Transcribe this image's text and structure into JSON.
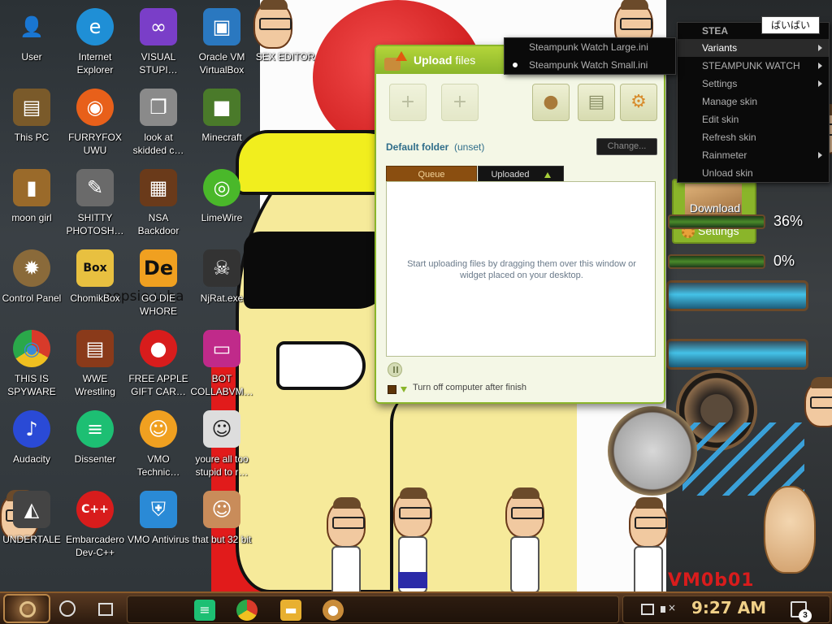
{
  "desktop": {
    "icons": [
      {
        "label": "User",
        "glyph": "👤",
        "color": "#5a4030"
      },
      {
        "label": "Internet Explorer",
        "glyph": "e",
        "color": "#1f8fd6"
      },
      {
        "label": "VISUAL STUPI…",
        "glyph": "∞",
        "color": "#7a3ec8"
      },
      {
        "label": "Oracle VM VirtualBox",
        "glyph": "▣",
        "color": "#2a78c0"
      },
      {
        "label": "SEX EDITOR",
        "glyph": "",
        "color": "#ffffff"
      },
      {
        "label": "This PC",
        "glyph": "▤",
        "color": "#7a5a2a"
      },
      {
        "label": "FURRYFOX UWU",
        "glyph": "◉",
        "color": "#e8601a"
      },
      {
        "label": "look at skidded c…",
        "glyph": "❐",
        "color": "#8a8a8a"
      },
      {
        "label": "Minecraft",
        "glyph": "■",
        "color": "#4a7a2a"
      },
      {
        "label": "moon girl",
        "glyph": "▮",
        "color": "#9a6a2a"
      },
      {
        "label": "SHITTY PHOTOSH…",
        "glyph": "✎",
        "color": "#6a6a6a"
      },
      {
        "label": "NSA Backdoor",
        "glyph": "▦",
        "color": "#6a3a1a"
      },
      {
        "label": "LimeWire",
        "glyph": "◎",
        "color": "#4ab82a"
      },
      {
        "label": "Control Panel",
        "glyph": "✹",
        "color": "#8a6a3a"
      },
      {
        "label": "ChomikBox",
        "glyph": "Box",
        "color": "#e8c040"
      },
      {
        "label": "GO DIE WHORE",
        "glyph": "De",
        "color": "#f0a020"
      },
      {
        "label": "NjRat.exe",
        "glyph": "☠",
        "color": "#333333"
      },
      {
        "label": "THIS IS SPYWARE",
        "glyph": "◉",
        "color": "#3a8ad6"
      },
      {
        "label": "WWE Wrestling",
        "glyph": "▤",
        "color": "#8a3a1a"
      },
      {
        "label": "FREE APPLE GIFT CAR…",
        "glyph": "●",
        "color": "#d81c1c"
      },
      {
        "label": "BOT COLLABVM…",
        "glyph": "▭",
        "color": "#c02a8a"
      },
      {
        "label": "Audacity",
        "glyph": "♪",
        "color": "#2a4ad6"
      },
      {
        "label": "Dissenter",
        "glyph": "≡",
        "color": "#1dbf73"
      },
      {
        "label": "VMO Technic…",
        "glyph": "☺",
        "color": "#f0a020"
      },
      {
        "label": "youre all too stupid to r…",
        "glyph": "☺",
        "color": "#dddddd"
      },
      {
        "label": "UNDERTALE",
        "glyph": "◭",
        "color": "#444444"
      },
      {
        "label": "Embarcadero Dev-C++",
        "glyph": "C++",
        "color": "#d81c1c"
      },
      {
        "label": "VMO Antivirus",
        "glyph": "⛨",
        "color": "#2a8ad6"
      },
      {
        "label": "that but 32 bit",
        "glyph": "☺",
        "color": "#c98c5a"
      }
    ]
  },
  "wallpaper": {
    "text_chunk": "oopsie u ha",
    "watermark": "VM0b01"
  },
  "upload_window": {
    "title_bold": "Upload",
    "title_rest": " files",
    "folder_label": "Default folder",
    "folder_value": "(unset)",
    "change_button": "Change...",
    "tab_queue": "Queue",
    "tab_uploaded": "Uploaded",
    "empty_message": "Start uploading files by dragging them over this window or widget placed on your desktop.",
    "shutdown_label": "Turn off computer after finish"
  },
  "widget": {
    "download_label": "Download",
    "settings_label": "Settings",
    "meter1_value": "36%",
    "meter2_value": "0%"
  },
  "context_menu": {
    "header": "STEA",
    "items": [
      {
        "label": "Variants",
        "has_submenu": true,
        "active": true
      },
      {
        "label": "STEAMPUNK WATCH",
        "has_submenu": true,
        "active": false
      },
      {
        "label": "Settings",
        "has_submenu": true,
        "active": false
      },
      {
        "label": "Manage skin",
        "has_submenu": false,
        "active": false
      },
      {
        "label": "Edit skin",
        "has_submenu": false,
        "active": false
      },
      {
        "label": "Refresh skin",
        "has_submenu": false,
        "active": false
      },
      {
        "label": "Rainmeter",
        "has_submenu": true,
        "active": false
      },
      {
        "label": "Unload skin",
        "has_submenu": false,
        "active": false
      }
    ]
  },
  "variants_submenu": {
    "items": [
      {
        "label": "Steampunk Watch Large.ini",
        "selected": false
      },
      {
        "label": "Steampunk Watch Small.ini",
        "selected": true
      }
    ]
  },
  "tooltip": {
    "text": "ばいばい"
  },
  "taskbar": {
    "time": "9:27 AM",
    "notification_count": "3",
    "apps": [
      {
        "name": "dissenter",
        "glyph": "≡",
        "color": "#1dbf73"
      },
      {
        "name": "chrome",
        "glyph": "◉",
        "color": "#3a8ad6"
      },
      {
        "name": "file-explorer",
        "glyph": "▬",
        "color": "#e8b030"
      },
      {
        "name": "chomikbox",
        "glyph": "●",
        "color": "#c98c3a"
      }
    ]
  }
}
